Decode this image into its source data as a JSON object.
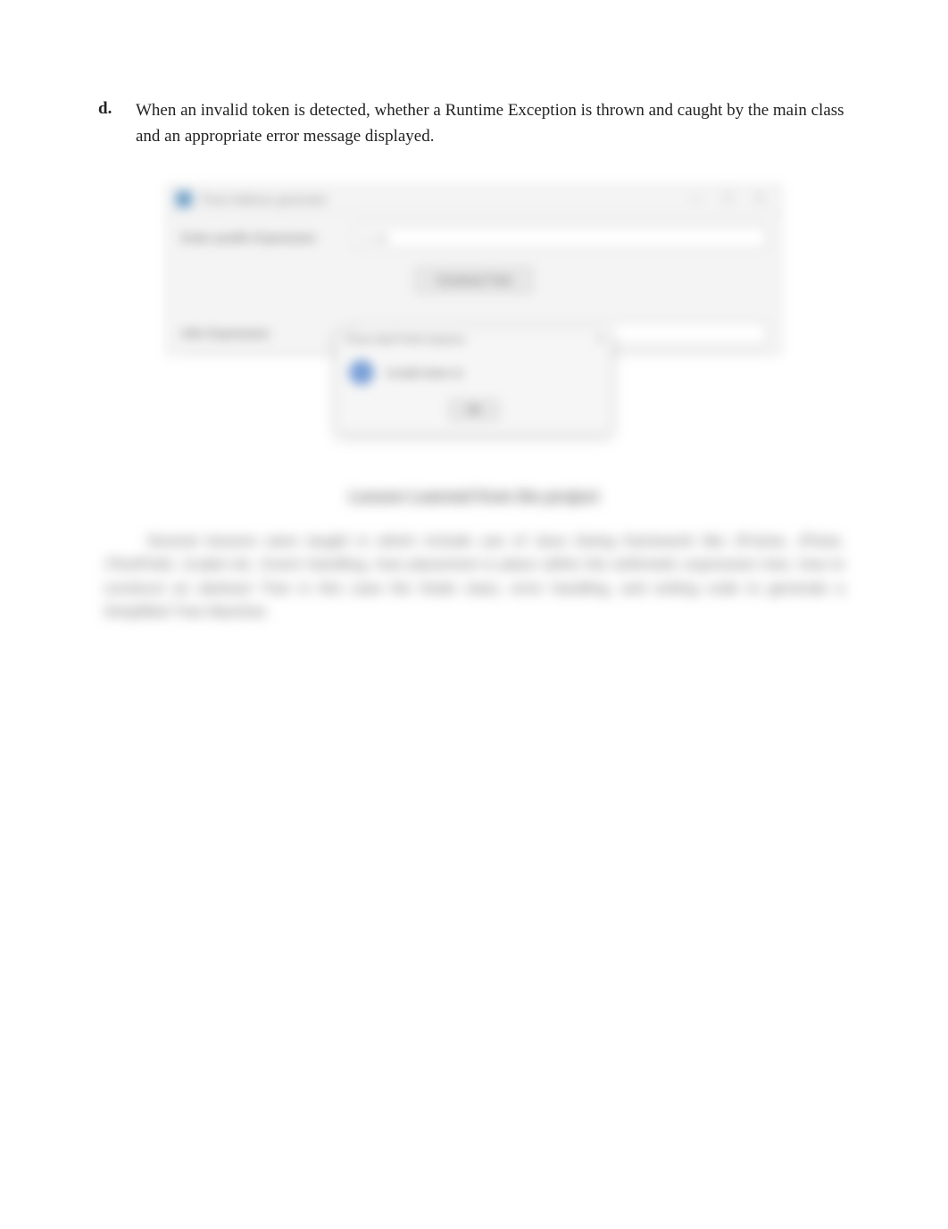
{
  "list": {
    "marker": "d.",
    "text": "When an invalid token is detected, whether a Runtime Exception is thrown and caught by the main class and an appropriate error message displayed."
  },
  "app": {
    "title": "Three Address generator",
    "min": "—",
    "max": "☐",
    "close": "✕",
    "label_input": "Enter postfix Expression",
    "input_value": "1 2 &",
    "evaluate": "Construct Tree",
    "label_output": "Infix Expression"
  },
  "dialog": {
    "title": "Three Add Prefix Express",
    "close": "✕",
    "message": "Invalid token &",
    "ok": "OK"
  },
  "lesson": {
    "heading": "Lesson Learned from the project",
    "para": "Several lessons were taught in which include use of Java Swing framework like JFrame, JPane, JTextField, JLabel etc. Event Handling, how placement is place within the arithmetic expression tree, how to construct an abstract Tree in this case the Node class, error handling, and writing code to generate a Simplified Tree Machine."
  }
}
